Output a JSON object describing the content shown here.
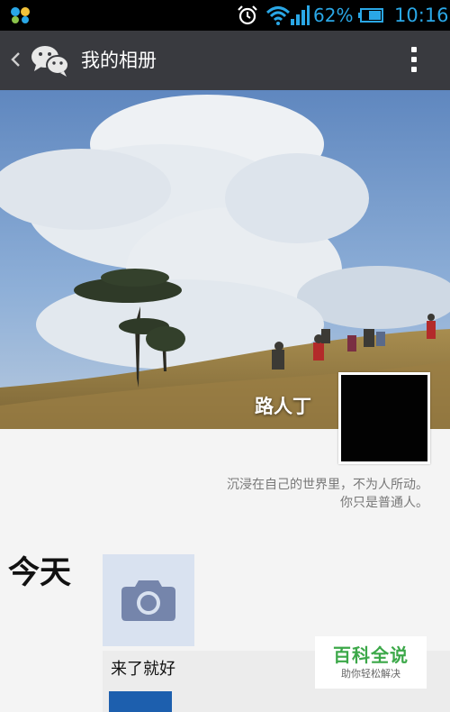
{
  "status_bar": {
    "battery_percent": "62%",
    "time": "10:16",
    "accent_color": "#2aa7e6"
  },
  "header": {
    "title": "我的相册",
    "back_icon": "chevron-left-icon",
    "app_icon": "wechat-icon",
    "menu_icon": "more-vertical-icon"
  },
  "profile": {
    "username": "路人丁",
    "signature_line1": "沉浸在自己的世界里，不为人所动。",
    "signature_line2": "你只是普通人。"
  },
  "timeline": {
    "date_label": "今天",
    "camera_icon": "camera-icon",
    "post_text": "来了就好"
  },
  "watermark": {
    "title": "百科全说",
    "subtitle": "助你轻松解决"
  }
}
